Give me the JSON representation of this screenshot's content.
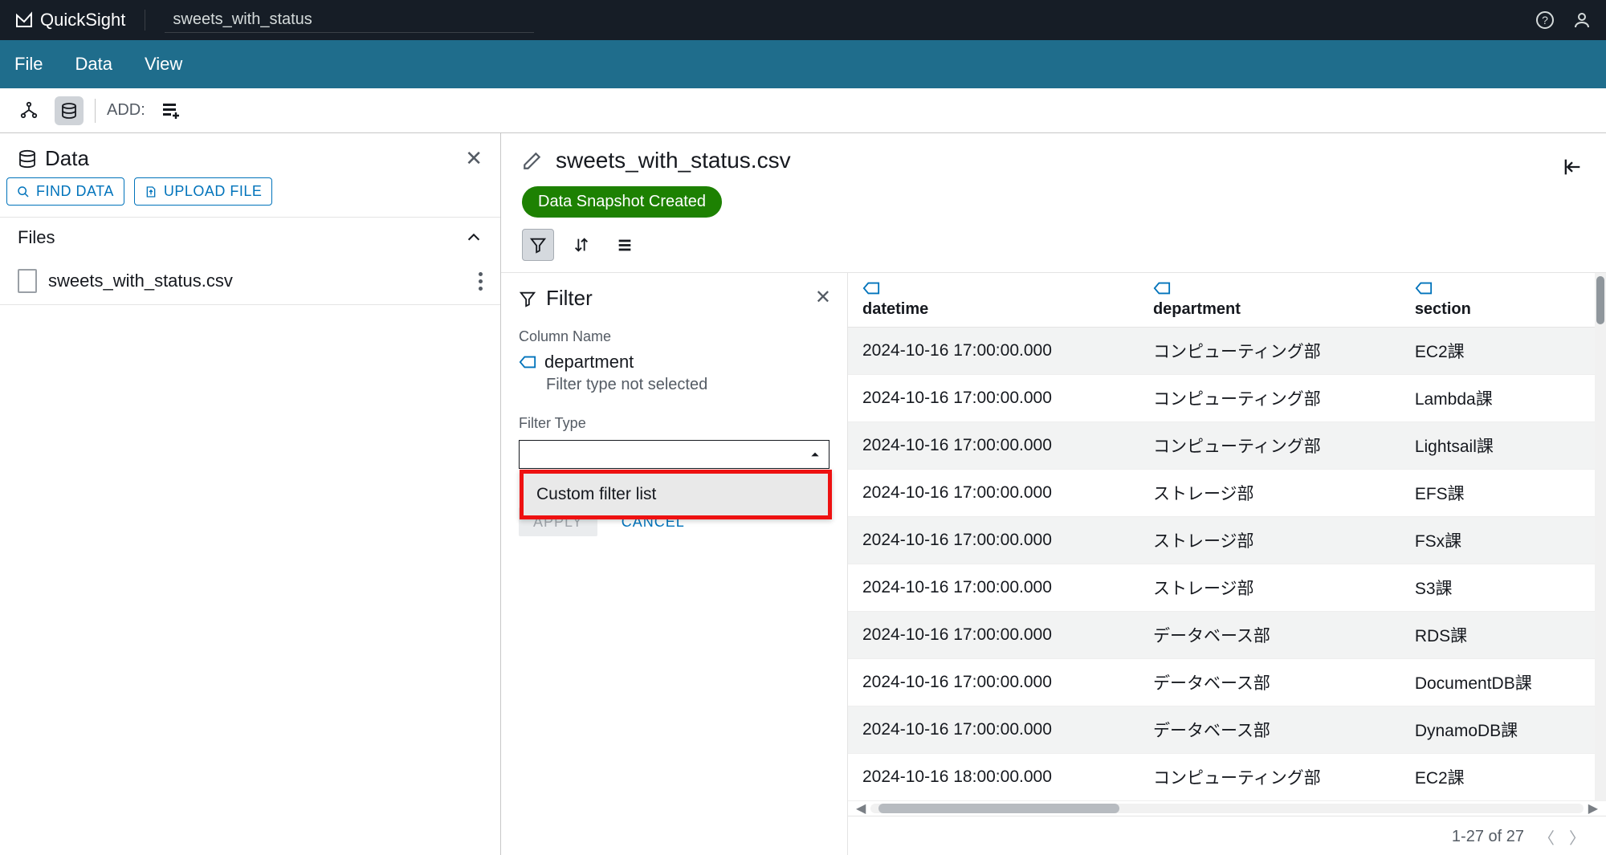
{
  "header": {
    "app_name": "QuickSight",
    "doc_title": "sweets_with_status"
  },
  "menu": {
    "file": "File",
    "data": "Data",
    "view": "View"
  },
  "toolbar": {
    "add_label": "ADD:"
  },
  "left_panel": {
    "title": "Data",
    "find_btn": "FIND DATA",
    "upload_btn": "UPLOAD FILE",
    "files_header": "Files",
    "file_name": "sweets_with_status.csv"
  },
  "center": {
    "file_name": "sweets_with_status.csv",
    "badge": "Data Snapshot Created"
  },
  "filter": {
    "title": "Filter",
    "column_name_label": "Column Name",
    "column_name_value": "department",
    "helper": "Filter type not selected",
    "filter_type_label": "Filter Type",
    "dropdown_option": "Custom filter list",
    "apply": "APPLY",
    "cancel": "CANCEL"
  },
  "table": {
    "columns": {
      "c0": "datetime",
      "c1": "department",
      "c2": "section"
    },
    "rows": [
      {
        "dt": "2024-10-16 17:00:00.000",
        "dept": "コンピューティング部",
        "sec": "EC2課"
      },
      {
        "dt": "2024-10-16 17:00:00.000",
        "dept": "コンピューティング部",
        "sec": "Lambda課"
      },
      {
        "dt": "2024-10-16 17:00:00.000",
        "dept": "コンピューティング部",
        "sec": "Lightsail課"
      },
      {
        "dt": "2024-10-16 17:00:00.000",
        "dept": "ストレージ部",
        "sec": "EFS課"
      },
      {
        "dt": "2024-10-16 17:00:00.000",
        "dept": "ストレージ部",
        "sec": "FSx課"
      },
      {
        "dt": "2024-10-16 17:00:00.000",
        "dept": "ストレージ部",
        "sec": "S3課"
      },
      {
        "dt": "2024-10-16 17:00:00.000",
        "dept": "データベース部",
        "sec": "RDS課"
      },
      {
        "dt": "2024-10-16 17:00:00.000",
        "dept": "データベース部",
        "sec": "DocumentDB課"
      },
      {
        "dt": "2024-10-16 17:00:00.000",
        "dept": "データベース部",
        "sec": "DynamoDB課"
      },
      {
        "dt": "2024-10-16 18:00:00.000",
        "dept": "コンピューティング部",
        "sec": "EC2課"
      }
    ]
  },
  "pager": {
    "text": "1-27 of 27"
  }
}
